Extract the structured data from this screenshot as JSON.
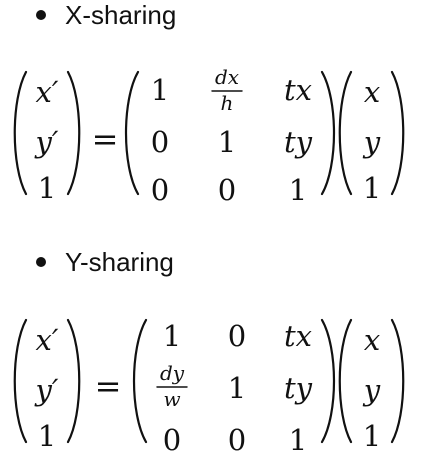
{
  "sections": [
    {
      "bullet_label": "X-sharing",
      "lhs": [
        "x′",
        "y′",
        "1"
      ],
      "equals": "=",
      "matrix": [
        [
          {
            "text": "1"
          },
          {
            "num": "dx",
            "den": "h"
          },
          {
            "text": "tx"
          }
        ],
        [
          {
            "text": "0"
          },
          {
            "text": "1"
          },
          {
            "text": "ty"
          }
        ],
        [
          {
            "text": "0"
          },
          {
            "text": "0"
          },
          {
            "text": "1"
          }
        ]
      ],
      "rhs": [
        "x",
        "y",
        "1"
      ]
    },
    {
      "bullet_label": "Y-sharing",
      "lhs": [
        "x′",
        "y′",
        "1"
      ],
      "equals": "=",
      "matrix": [
        [
          {
            "text": "1"
          },
          {
            "text": "0"
          },
          {
            "text": "tx"
          }
        ],
        [
          {
            "num": "dy",
            "den": "w"
          },
          {
            "text": "1"
          },
          {
            "text": "ty"
          }
        ],
        [
          {
            "text": "0"
          },
          {
            "text": "0"
          },
          {
            "text": "1"
          }
        ]
      ],
      "rhs": [
        "x",
        "y",
        "1"
      ]
    }
  ]
}
